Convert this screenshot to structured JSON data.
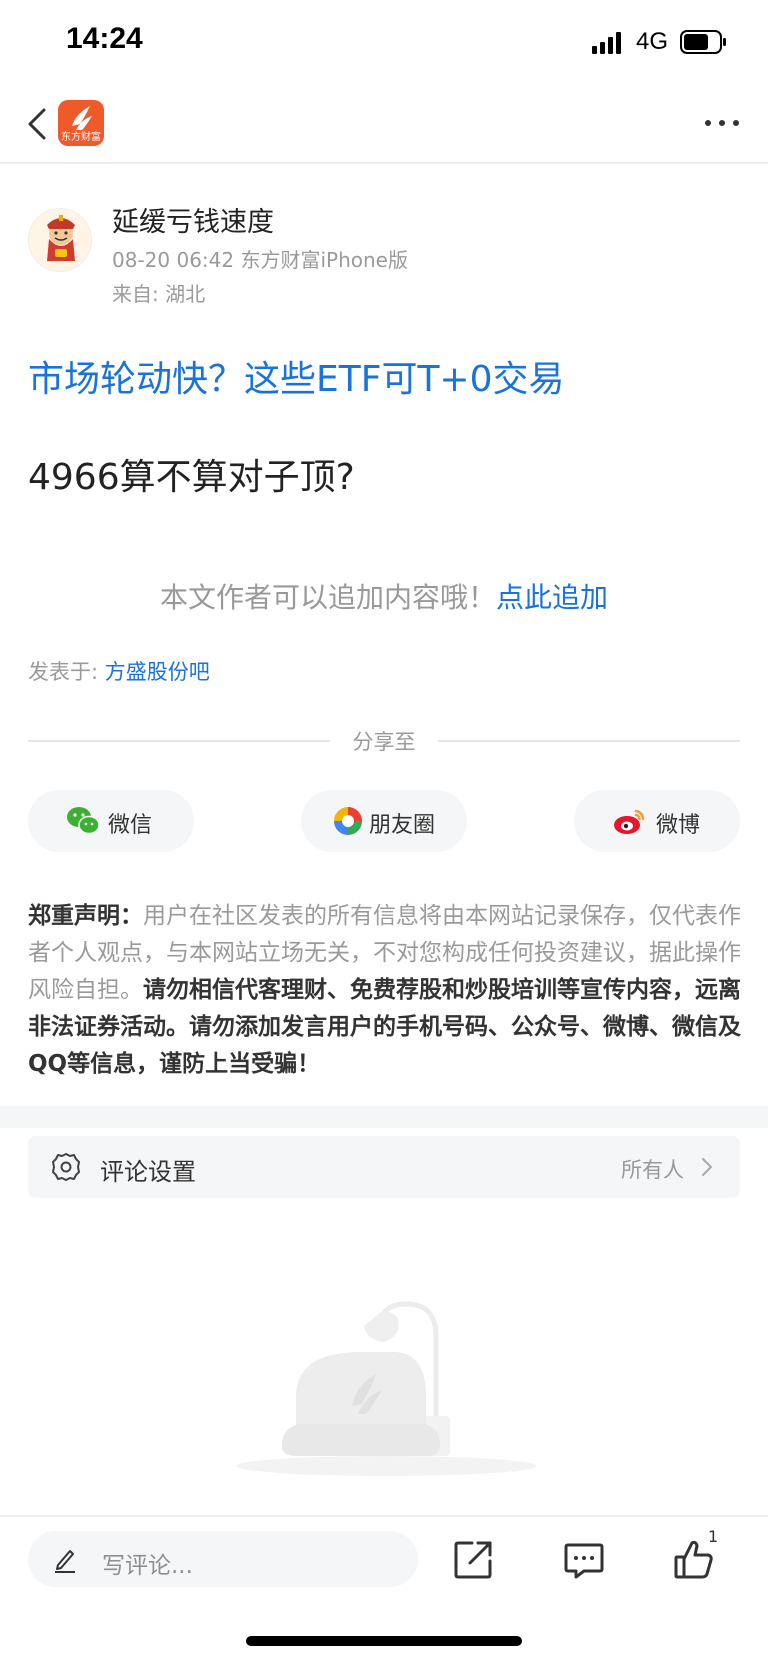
{
  "status_bar": {
    "time": "14:24",
    "network": "4G"
  },
  "nav": {
    "app_logo_text": "东方财富"
  },
  "post": {
    "author_name": "延缓亏钱速度",
    "meta": "08-20 06:42 东方财富iPhone版",
    "location": "来自: 湖北",
    "promo_link": "市场轮动快？这些ETF可T+0交易",
    "body": "4966算不算对子顶?",
    "append_tip": "本文作者可以追加内容哦！",
    "append_link": "点此追加",
    "posted_in_label": "发表于: ",
    "posted_in_bar": "方盛股份吧"
  },
  "share": {
    "title": "分享至",
    "buttons": [
      {
        "label": "微信",
        "icon": "wechat-icon"
      },
      {
        "label": "朋友圈",
        "icon": "moments-icon"
      },
      {
        "label": "微博",
        "icon": "weibo-icon"
      }
    ]
  },
  "disclaimer": {
    "lead": "郑重声明：",
    "normal": "用户在社区发表的所有信息将由本网站记录保存，仅代表作者个人观点，与本网站立场无关，不对您构成任何投资建议，据此操作风险自担。",
    "strong": "请勿相信代客理财、免费荐股和炒股培训等宣传内容，远离非法证券活动。请勿添加发言用户的手机号码、公众号、微博、微信及QQ等信息，谨防上当受骗！"
  },
  "comment_settings": {
    "label": "评论设置",
    "value": "所有人"
  },
  "bottom_bar": {
    "placeholder": "写评论...",
    "like_count": "1"
  },
  "colors": {
    "link": "#1a73d9",
    "brand": "#ee5a2a",
    "muted": "#9a9a9a"
  }
}
